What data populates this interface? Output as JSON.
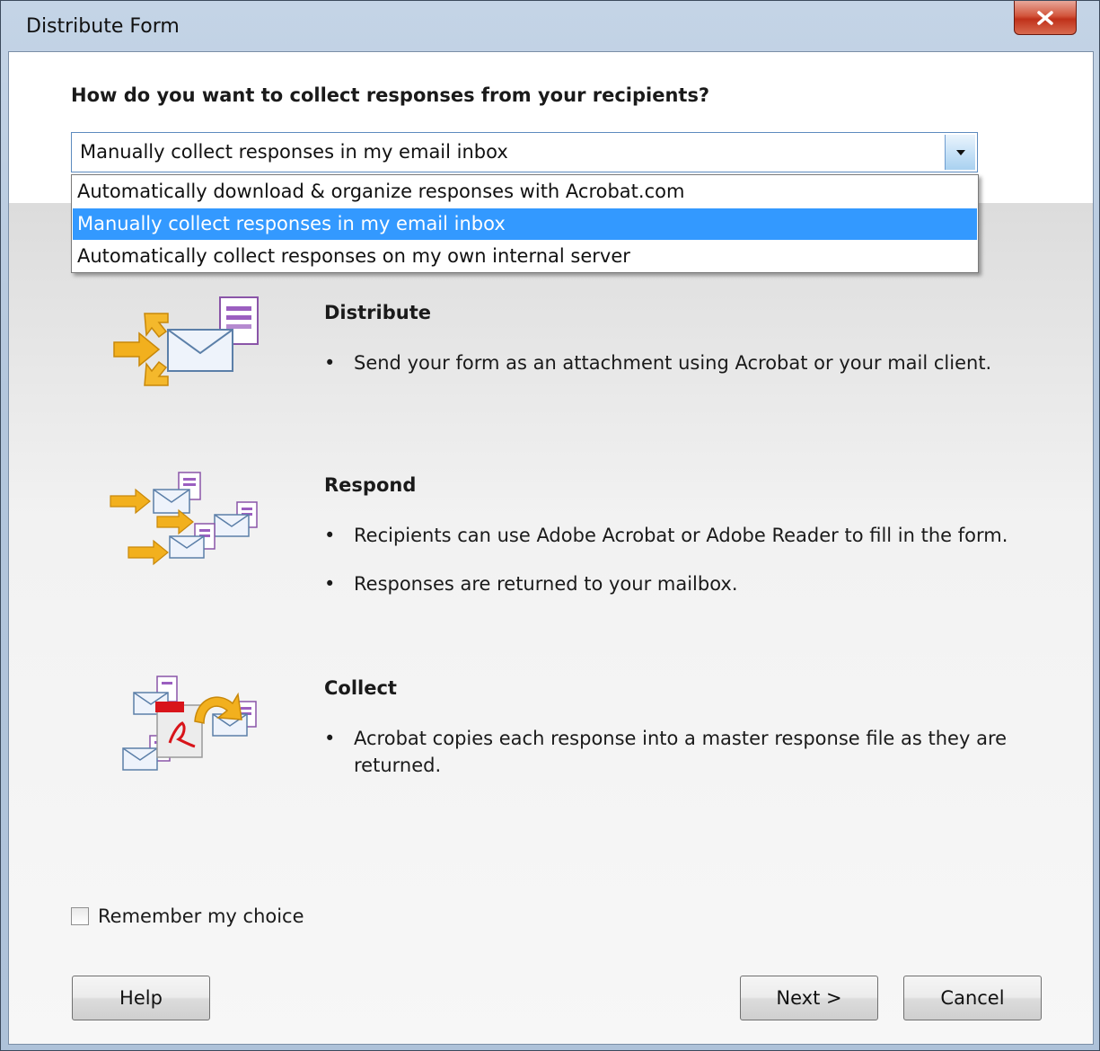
{
  "window": {
    "title": "Distribute Form"
  },
  "question": "How do you want to collect responses from your recipients?",
  "combo": {
    "value": "Manually collect responses in my email inbox",
    "options": [
      "Automatically download & organize responses with Acrobat.com",
      "Manually collect responses in my email inbox",
      "Automatically collect responses on my own internal server"
    ],
    "selected_index": 1
  },
  "sections": [
    {
      "title": "Distribute",
      "bullets": [
        "Send your form as an attachment using Acrobat or your mail client."
      ],
      "icon": "distribute-envelope-icon"
    },
    {
      "title": "Respond",
      "bullets": [
        "Recipients can use Adobe Acrobat or Adobe Reader to fill in the form.",
        "Responses are returned to your mailbox."
      ],
      "icon": "respond-envelopes-icon"
    },
    {
      "title": "Collect",
      "bullets": [
        "Acrobat copies each response into a master response file as they are returned."
      ],
      "icon": "collect-pdf-icon"
    }
  ],
  "bullet_char": "•",
  "remember": {
    "label": "Remember my choice",
    "checked": false
  },
  "buttons": {
    "help": "Help",
    "next": "Next >",
    "cancel": "Cancel"
  },
  "colors": {
    "selection": "#3399ff",
    "close": "#c0311a"
  }
}
